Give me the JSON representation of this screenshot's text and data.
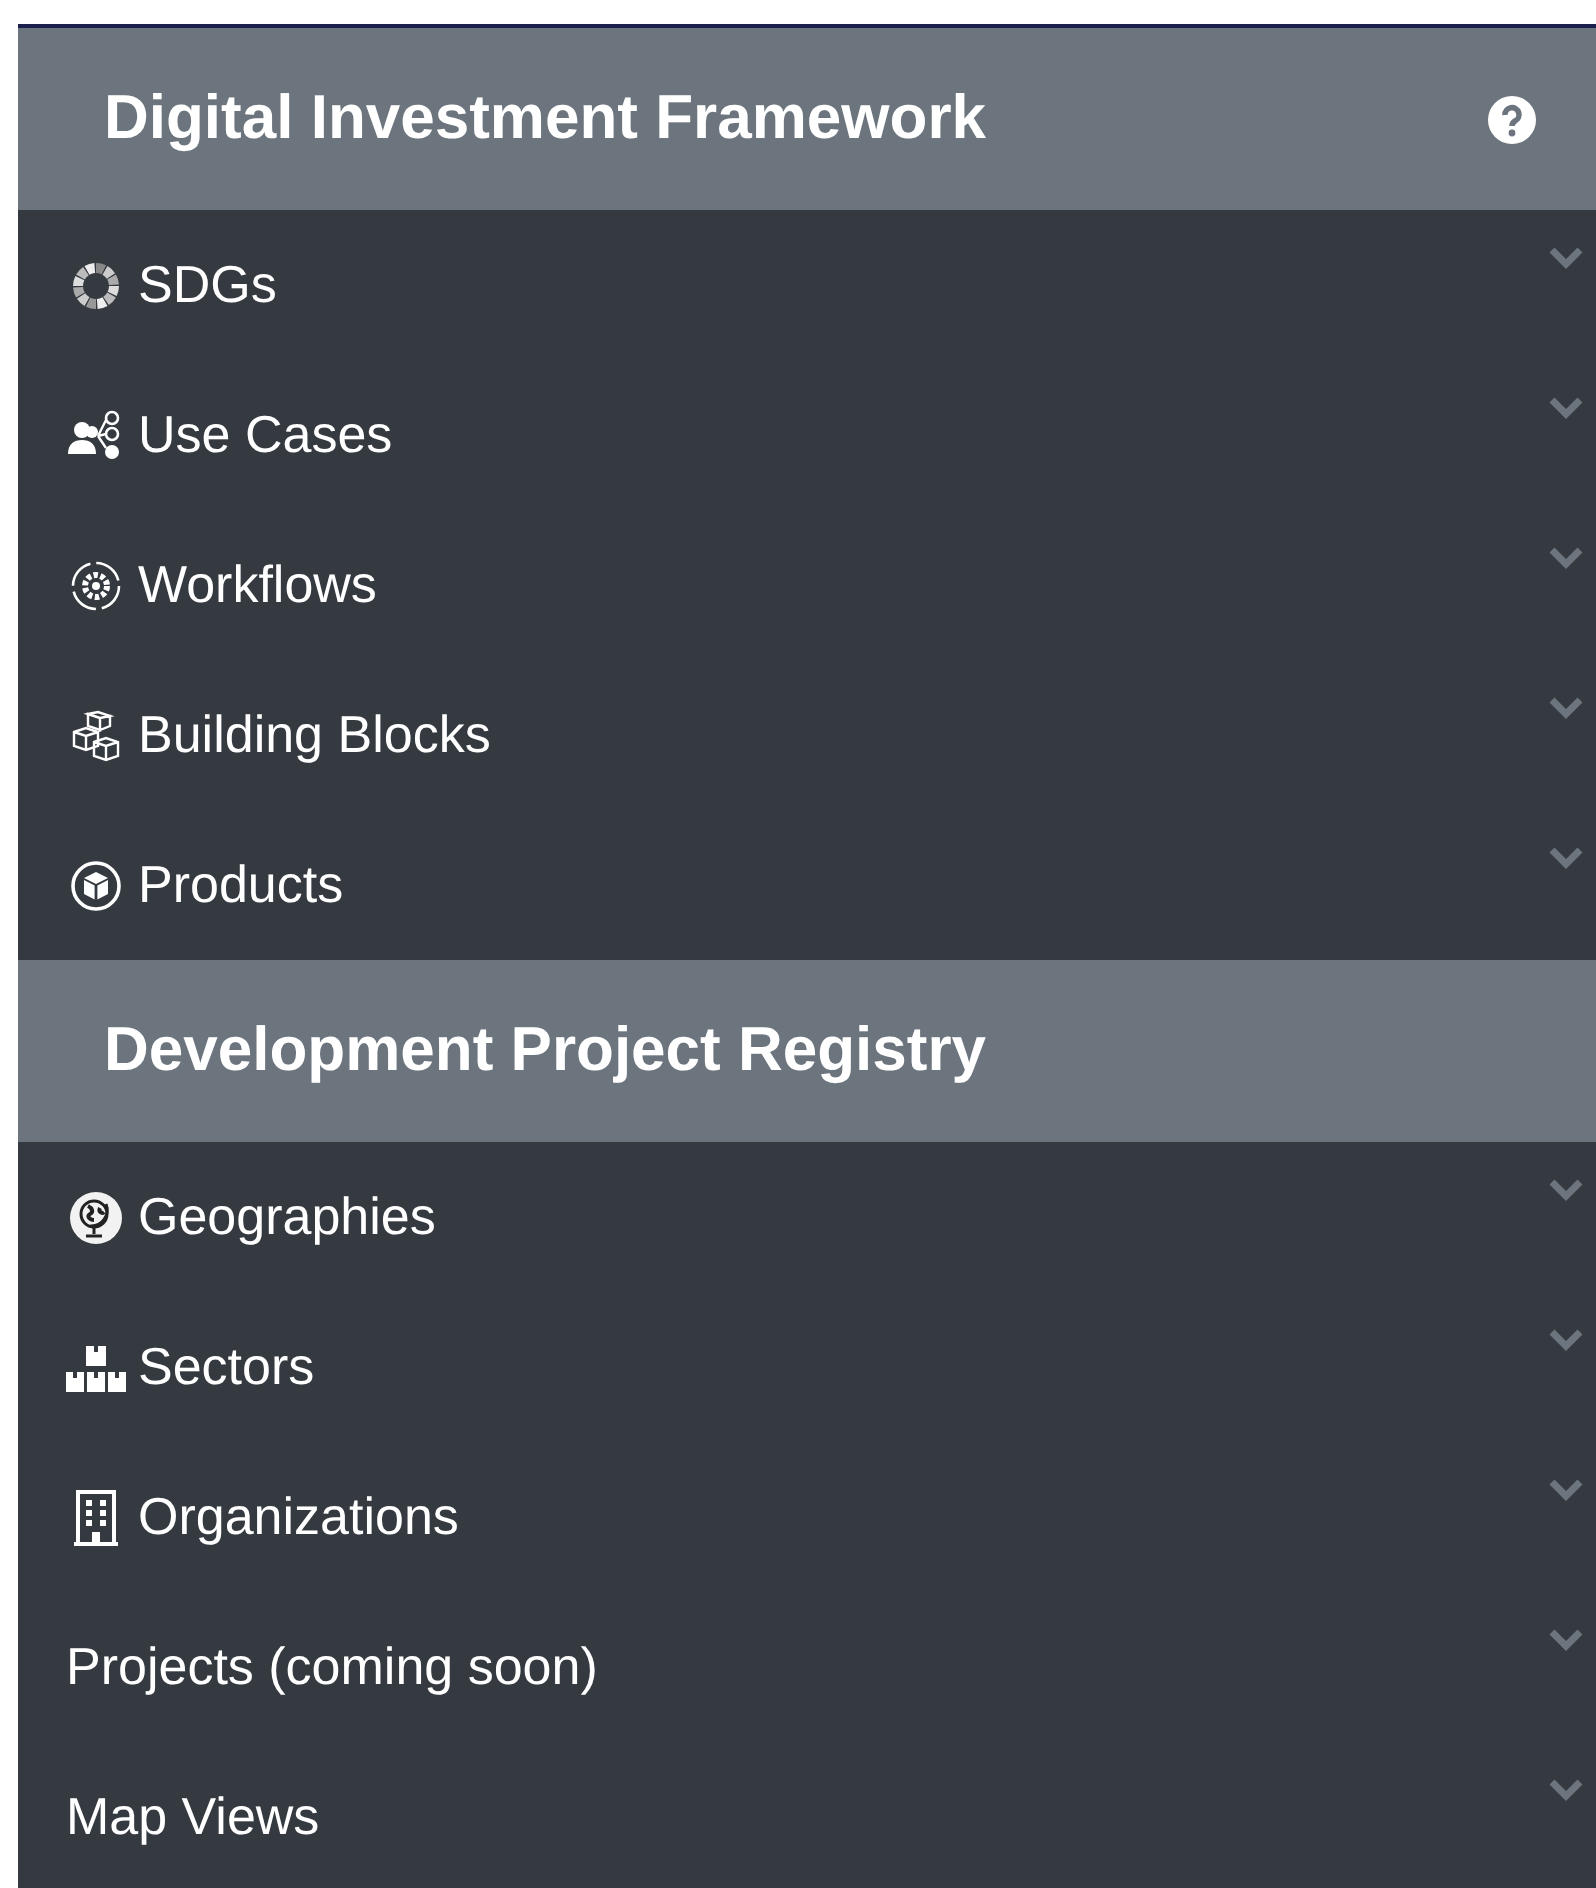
{
  "sections": [
    {
      "title": "Digital Investment Framework",
      "help": true,
      "items": [
        {
          "label": "SDGs",
          "kind": "icon",
          "expanded": false
        },
        {
          "label": "Use Cases",
          "kind": "icon",
          "expanded": false
        },
        {
          "label": "Workflows",
          "kind": "icon",
          "expanded": false
        },
        {
          "label": "Building Blocks",
          "kind": "icon",
          "expanded": false
        },
        {
          "label": "Products",
          "kind": "icon",
          "expanded": false
        }
      ]
    },
    {
      "title": "Development Project Registry",
      "help": false,
      "items": [
        {
          "label": "Geographies",
          "kind": "icon",
          "expanded": false
        },
        {
          "label": "Sectors",
          "kind": "icon",
          "expanded": false
        },
        {
          "label": "Organizations",
          "kind": "icon",
          "expanded": false
        },
        {
          "label": "Projects (coming soon)",
          "kind": "text",
          "expanded": false
        },
        {
          "label": "Map Views",
          "kind": "text",
          "expanded": false
        }
      ]
    }
  ]
}
